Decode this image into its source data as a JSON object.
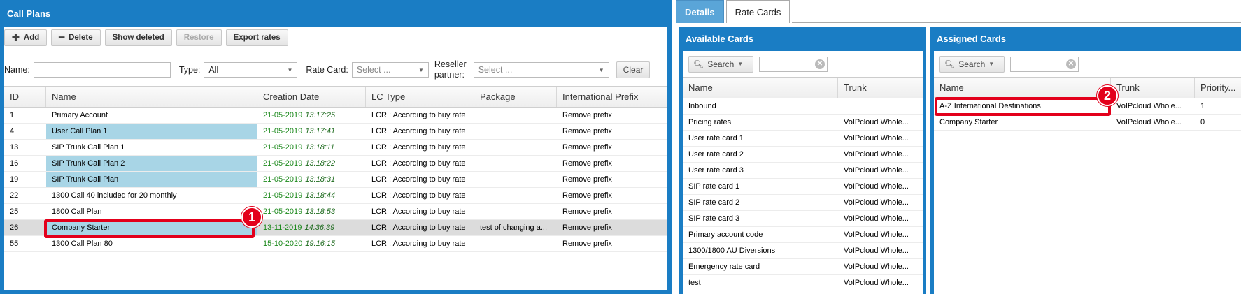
{
  "left": {
    "title": "Call Plans",
    "toolbar": {
      "add": "Add",
      "delete": "Delete",
      "show_deleted": "Show deleted",
      "restore": "Restore",
      "export": "Export rates"
    },
    "filters": {
      "name_label": "Name:",
      "type_label": "Type:",
      "type_value": "All",
      "rate_card_label": "Rate Card:",
      "rate_card_placeholder": "Select ...",
      "reseller_label_1": "Reseller",
      "reseller_label_2": "partner:",
      "reseller_placeholder": "Select ...",
      "clear": "Clear"
    },
    "columns": [
      "ID",
      "Name",
      "Creation Date",
      "LC Type",
      "Package",
      "International Prefix"
    ],
    "rows": [
      {
        "id": "1",
        "name": "Primary Account",
        "date": "21-05-2019",
        "time": "13:17:25",
        "lc": "LCR : According to buy rate",
        "pkg": "",
        "prefix": "Remove prefix"
      },
      {
        "id": "4",
        "name": "User Call Plan 1",
        "date": "21-05-2019",
        "time": "13:17:41",
        "lc": "LCR : According to buy rate",
        "pkg": "",
        "prefix": "Remove prefix"
      },
      {
        "id": "13",
        "name": "SIP Trunk Call Plan 1",
        "date": "21-05-2019",
        "time": "13:18:11",
        "lc": "LCR : According to buy rate",
        "pkg": "",
        "prefix": "Remove prefix"
      },
      {
        "id": "16",
        "name": "SIP Trunk Call Plan 2",
        "date": "21-05-2019",
        "time": "13:18:22",
        "lc": "LCR : According to buy rate",
        "pkg": "",
        "prefix": "Remove prefix"
      },
      {
        "id": "19",
        "name": "SIP Trunk Call Plan",
        "date": "21-05-2019",
        "time": "13:18:31",
        "lc": "LCR : According to buy rate",
        "pkg": "",
        "prefix": "Remove prefix"
      },
      {
        "id": "22",
        "name": "1300 Call 40 included for 20 monthly",
        "date": "21-05-2019",
        "time": "13:18:44",
        "lc": "LCR : According to buy rate",
        "pkg": "",
        "prefix": "Remove prefix"
      },
      {
        "id": "25",
        "name": "1800 Call Plan",
        "date": "21-05-2019",
        "time": "13:18:53",
        "lc": "LCR : According to buy rate",
        "pkg": "",
        "prefix": "Remove prefix"
      },
      {
        "id": "26",
        "name": "Company Starter",
        "date": "13-11-2019",
        "time": "14:36:39",
        "lc": "LCR : According to buy rate",
        "pkg": "test of changing a...",
        "prefix": "Remove prefix"
      },
      {
        "id": "55",
        "name": "1300 Call Plan 80",
        "date": "15-10-2020",
        "time": "19:16:15",
        "lc": "LCR : According to buy rate",
        "pkg": "",
        "prefix": "Remove prefix"
      }
    ]
  },
  "tabs": [
    "Details",
    "Rate Cards"
  ],
  "available": {
    "title": "Available Cards",
    "search": "Search",
    "columns": [
      "Name",
      "Trunk"
    ],
    "rows": [
      {
        "name": "Inbound",
        "trunk": ""
      },
      {
        "name": "Pricing rates",
        "trunk": "VoIPcloud Whole..."
      },
      {
        "name": "User rate card 1",
        "trunk": "VoIPcloud Whole..."
      },
      {
        "name": "User rate card 2",
        "trunk": "VoIPcloud Whole..."
      },
      {
        "name": "User rate card 3",
        "trunk": "VoIPcloud Whole..."
      },
      {
        "name": "SIP rate card 1",
        "trunk": "VoIPcloud Whole..."
      },
      {
        "name": "SIP rate card 2",
        "trunk": "VoIPcloud Whole..."
      },
      {
        "name": "SIP rate card 3",
        "trunk": "VoIPcloud Whole..."
      },
      {
        "name": "Primary account code",
        "trunk": "VoIPcloud Whole..."
      },
      {
        "name": "1300/1800 AU Diversions",
        "trunk": "VoIPcloud Whole..."
      },
      {
        "name": "Emergency rate card",
        "trunk": "VoIPcloud Whole..."
      },
      {
        "name": "test",
        "trunk": "VoIPcloud Whole..."
      }
    ]
  },
  "assigned": {
    "title": "Assigned Cards",
    "search": "Search",
    "columns": [
      "Name",
      "Trunk",
      "Priority..."
    ],
    "rows": [
      {
        "name": "A-Z International Destinations",
        "trunk": "VoIPcloud Whole...",
        "priority": "1"
      },
      {
        "name": "Company Starter",
        "trunk": "VoIPcloud Whole...",
        "priority": "0"
      }
    ]
  },
  "markers": [
    "1",
    "2"
  ],
  "colors": {
    "header_blue": "#1a7dc4",
    "row_highlight": "#a8d5e6",
    "marker_red": "#e3001b",
    "date_green": "#1d8a1d"
  }
}
